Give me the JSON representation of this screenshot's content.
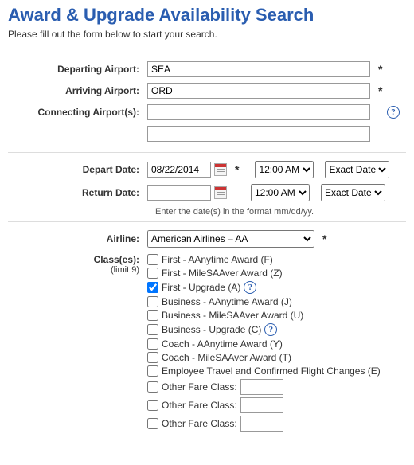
{
  "title": "Award & Upgrade Availability Search",
  "subtitle": "Please fill out the form below to start your search.",
  "labels": {
    "departing": "Departing Airport:",
    "arriving": "Arriving Airport:",
    "connecting": "Connecting Airport(s):",
    "depart_date": "Depart Date:",
    "return_date": "Return Date:",
    "airline": "Airline:",
    "classes": "Class(es):",
    "limit": "(limit 9)"
  },
  "fields": {
    "departing": "SEA",
    "arriving": "ORD",
    "connecting1": "",
    "connecting2": "",
    "depart_date": "08/22/2014",
    "return_date": "",
    "depart_time": "12:00 AM",
    "return_time": "12:00 AM",
    "depart_exact": "Exact Date",
    "return_exact": "Exact Date",
    "airline": "American Airlines – AA"
  },
  "date_hint": "Enter the date(s) in the format mm/dd/yy.",
  "classes": [
    {
      "label": "First - AAnytime Award (F)",
      "checked": false,
      "help": false
    },
    {
      "label": "First - MileSAAver Award (Z)",
      "checked": false,
      "help": false
    },
    {
      "label": "First - Upgrade (A)",
      "checked": true,
      "help": true
    },
    {
      "label": "Business - AAnytime Award (J)",
      "checked": false,
      "help": false
    },
    {
      "label": "Business - MileSAAver Award (U)",
      "checked": false,
      "help": false
    },
    {
      "label": "Business - Upgrade (C)",
      "checked": false,
      "help": true
    },
    {
      "label": "Coach - AAnytime Award (Y)",
      "checked": false,
      "help": false
    },
    {
      "label": "Coach - MileSAAver Award (T)",
      "checked": false,
      "help": false
    },
    {
      "label": "Employee Travel and Confirmed Flight Changes (E)",
      "checked": false,
      "help": false
    }
  ],
  "other_fare_label": "Other Fare Class:",
  "other_fare_count": 3,
  "required_mark": "*"
}
